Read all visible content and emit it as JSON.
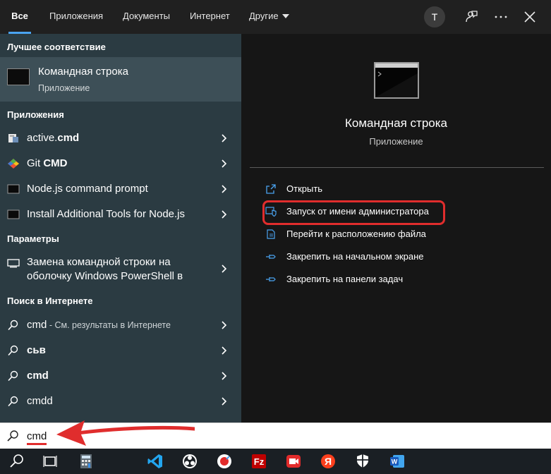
{
  "tabs": [
    {
      "label": "Все",
      "active": true
    },
    {
      "label": "Приложения"
    },
    {
      "label": "Документы"
    },
    {
      "label": "Интернет"
    },
    {
      "label": "Другие"
    }
  ],
  "user_initial": "T",
  "best_match": {
    "header": "Лучшее соответствие",
    "title": "Командная строка",
    "subtitle": "Приложение"
  },
  "apps": {
    "header": "Приложения",
    "items": [
      {
        "prefix": "active.",
        "bold": "cmd",
        "icon": "script-icon"
      },
      {
        "prefix": "Git ",
        "bold": "CMD",
        "icon": "git-icon"
      },
      {
        "prefix": "Node.js command prompt",
        "bold": "",
        "icon": "console-icon"
      },
      {
        "prefix": "Install Additional Tools for Node.js",
        "bold": "",
        "icon": "console-icon"
      }
    ]
  },
  "settings": {
    "header": "Параметры",
    "item_line1": "Замена командной строки на",
    "item_line2": "оболочку Windows PowerShell в"
  },
  "web": {
    "header": "Поиск в Интернете",
    "items": [
      {
        "bold": "cmd",
        "muted": " - См. результаты в Интернете"
      },
      {
        "bold": "сьв",
        "muted": ""
      },
      {
        "bold": "cmd",
        "muted": ""
      },
      {
        "bold": "cmdd",
        "muted": ""
      }
    ]
  },
  "preview": {
    "title": "Командная строка",
    "subtitle": "Приложение",
    "actions": [
      {
        "label": "Открыть",
        "icon": "open-icon"
      },
      {
        "label": "Запуск от имени администратора",
        "icon": "shield-icon"
      },
      {
        "label": "Перейти к расположению файла",
        "icon": "folder-icon"
      },
      {
        "label": "Закрепить на начальном экране",
        "icon": "pin-icon"
      },
      {
        "label": "Закрепить на панели задач",
        "icon": "pin-icon"
      }
    ]
  },
  "search": {
    "value": "cmd"
  },
  "colors": {
    "accent": "#4aa3f0",
    "annotation": "#e02d2d",
    "left_panel": "#2b3b42",
    "right_panel": "#161616"
  },
  "taskbar_icons": [
    "search-icon",
    "task-view-icon",
    "calculator-icon",
    "vscode-icon",
    "obs-icon",
    "yandex-browser-icon",
    "filezilla-icon",
    "screen-recorder-icon",
    "yandex-icon",
    "shield-icon",
    "word-icon"
  ]
}
